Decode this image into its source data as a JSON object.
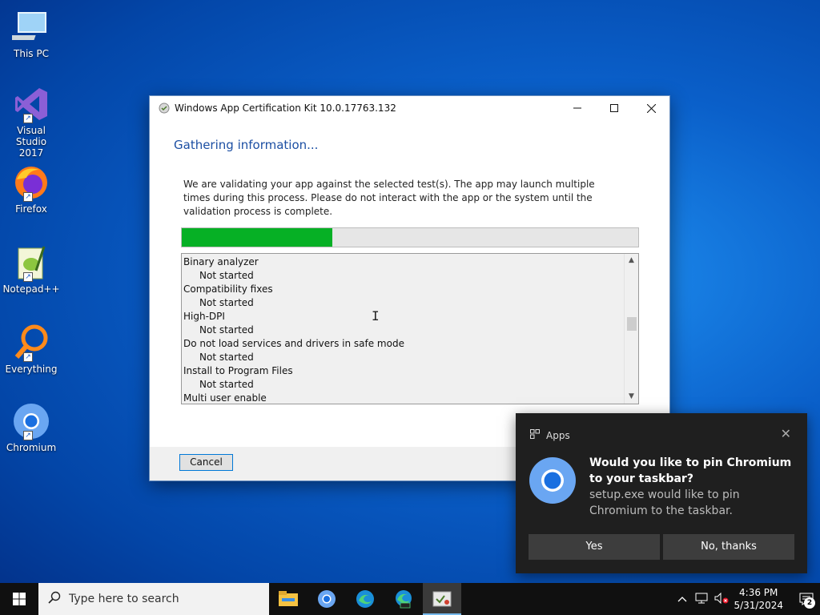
{
  "desktop": {
    "icons": [
      {
        "label": "This PC"
      },
      {
        "label": "Visual Studio 2017"
      },
      {
        "label": "Firefox"
      },
      {
        "label": "Notepad++"
      },
      {
        "label": "Everything"
      },
      {
        "label": "Chromium"
      }
    ]
  },
  "dialog": {
    "title": "Windows App Certification Kit 10.0.17763.132",
    "heading": "Gathering information...",
    "description": "We are validating your app against the selected test(s). The app may launch multiple times during this process. Please do not interact with the app or the system until the validation process is complete.",
    "progress_fraction": 0.33,
    "list": [
      {
        "name": "Binary analyzer",
        "status": "Not started"
      },
      {
        "name": "Compatibility fixes",
        "status": "Not started"
      },
      {
        "name": "High-DPI",
        "status": "Not started"
      },
      {
        "name": "Do not load services and drivers in safe mode",
        "status": "Not started"
      },
      {
        "name": "Install to Program Files",
        "status": "Not started"
      },
      {
        "name": "Multi user enable",
        "status": ""
      }
    ],
    "cancel_label": "Cancel"
  },
  "toast": {
    "app": "Apps",
    "title": "Would you like to pin Chromium to your taskbar?",
    "body": "setup.exe would like to pin Chromium to the taskbar.",
    "yes_label": "Yes",
    "no_label": "No, thanks"
  },
  "taskbar": {
    "search_placeholder": "Type here to search",
    "time": "4:36 PM",
    "date": "5/31/2024",
    "notification_count": "2"
  },
  "colors": {
    "progress_fill": "#06b025",
    "heading": "#1c4fa3",
    "toast_bg": "#1f1f1f"
  }
}
